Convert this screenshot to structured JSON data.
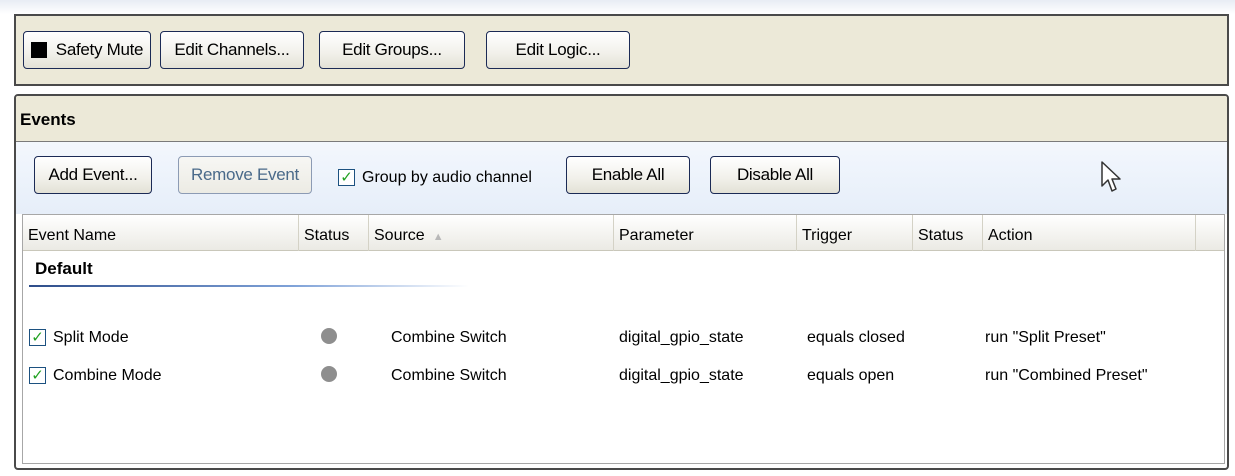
{
  "toolbar": {
    "safety_mute_label": "Safety Mute",
    "edit_channels_label": "Edit Channels...",
    "edit_groups_label": "Edit Groups...",
    "edit_logic_label": "Edit Logic..."
  },
  "events": {
    "title": "Events",
    "add_event_label": "Add Event...",
    "remove_event_label": "Remove Event",
    "group_by_label": "Group by audio channel",
    "group_by_checked": true,
    "enable_all_label": "Enable All",
    "disable_all_label": "Disable All",
    "columns": [
      "Event Name",
      "Status",
      "Source",
      "Parameter",
      "Trigger",
      "Status",
      "Action"
    ],
    "sorted_column": "Source",
    "group_name": "Default",
    "rows": [
      {
        "enabled": true,
        "name": "Split Mode",
        "status": "inactive",
        "source": "Combine Switch",
        "parameter": "digital_gpio_state",
        "trigger": "equals closed",
        "trigger_status": "",
        "action": "run \"Split Preset\""
      },
      {
        "enabled": true,
        "name": "Combine Mode",
        "status": "inactive",
        "source": "Combine Switch",
        "parameter": "digital_gpio_state",
        "trigger": "equals open",
        "trigger_status": "",
        "action": "run \"Combined Preset\""
      }
    ]
  },
  "colors": {
    "panel_bg": "#ece9d8",
    "toolbar_blue": "#e6eef9",
    "check_green": "#21a121",
    "status_gray": "#8e8e8e"
  },
  "icons": {
    "checkbox": "checkmark-icon",
    "status": "status-dot-icon",
    "sort": "sort-ascending-icon",
    "cursor": "mouse-pointer-icon"
  }
}
